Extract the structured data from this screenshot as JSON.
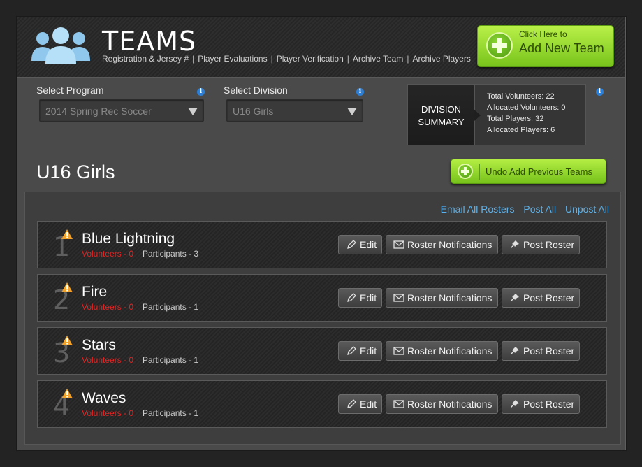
{
  "header": {
    "title": "TEAMS",
    "nav": [
      {
        "label": "Registration & Jersey #"
      },
      {
        "label": "Player Evaluations"
      },
      {
        "label": "Player Verification"
      },
      {
        "label": "Archive Team"
      },
      {
        "label": "Archive Players"
      }
    ],
    "add_team": {
      "small": "Click Here to",
      "big": "Add New Team"
    }
  },
  "filters": {
    "program_label": "Select Program",
    "program_value": "2014 Spring Rec Soccer",
    "division_label": "Select Division",
    "division_value": "U16 Girls"
  },
  "summary": {
    "tab_line1": "DIVISION",
    "tab_line2": "SUMMARY",
    "lines": [
      "Total Volunteers: 22",
      "Allocated Volunteers: 0",
      "Total Players: 32",
      "Allocated Players: 6"
    ]
  },
  "division_heading": "U16 Girls",
  "undo_label": "Undo Add Previous Teams",
  "actions": {
    "email_all": "Email All Rosters",
    "post_all": "Post All",
    "unpost_all": "Unpost All"
  },
  "team_buttons": {
    "edit": "Edit",
    "notify": "Roster Notifications",
    "post": "Post Roster"
  },
  "teams": [
    {
      "num": "1",
      "name": "Blue Lightning",
      "volunteers": "Volunteers - 0",
      "participants": "Participants - 3"
    },
    {
      "num": "2",
      "name": "Fire",
      "volunteers": "Volunteers - 0",
      "participants": "Participants - 1"
    },
    {
      "num": "3",
      "name": "Stars",
      "volunteers": "Volunteers - 0",
      "participants": "Participants - 1"
    },
    {
      "num": "4",
      "name": "Waves",
      "volunteers": "Volunteers - 0",
      "participants": "Participants - 1"
    }
  ],
  "colors": {
    "accent_green": "#8fd62c",
    "link_blue": "#5fb1e8",
    "warning_red": "#e52222"
  },
  "icons": [
    "people-icon",
    "plus-icon",
    "info-icon",
    "warning-icon",
    "pencil-icon",
    "envelope-icon",
    "pin-icon",
    "chevron-down-icon"
  ]
}
